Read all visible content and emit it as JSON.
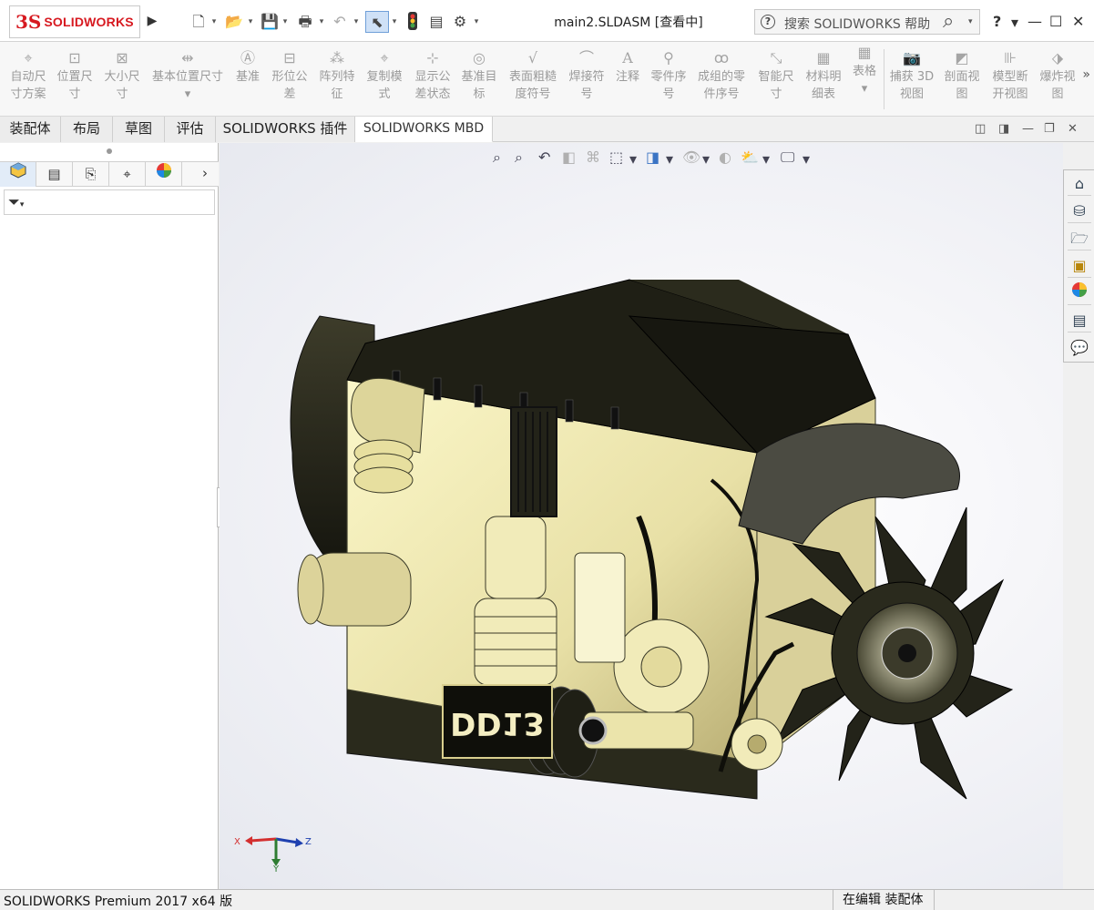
{
  "app": {
    "logo_ds": "3S",
    "logo_text": "SOLIDWORKS",
    "document_title": "main2.SLDASM [查看中]"
  },
  "search": {
    "help_icon": "?",
    "placeholder": "搜索 SOLIDWORKS 帮助"
  },
  "title_buttons": {
    "help": "?",
    "minimize": "—",
    "maximize": "☐",
    "close": "✕"
  },
  "command_manager": {
    "items": [
      {
        "l1": "自动尺",
        "l2": "寸方案"
      },
      {
        "l1": "位置尺",
        "l2": "寸"
      },
      {
        "l1": "大小尺",
        "l2": "寸"
      },
      {
        "l1": "基本位置尺寸",
        "l2": "▾"
      },
      {
        "l1": "基准",
        "l2": ""
      },
      {
        "l1": "形位公",
        "l2": "差"
      },
      {
        "l1": "阵列特",
        "l2": "征"
      },
      {
        "l1": "复制模",
        "l2": "式"
      },
      {
        "l1": "显示公",
        "l2": "差状态"
      },
      {
        "l1": "基准目",
        "l2": "标"
      },
      {
        "l1": "表面粗糙",
        "l2": "度符号"
      },
      {
        "l1": "焊接符",
        "l2": "号"
      },
      {
        "l1": "注释",
        "l2": ""
      },
      {
        "l1": "零件序",
        "l2": "号"
      },
      {
        "l1": "成组的零",
        "l2": "件序号"
      },
      {
        "l1": "智能尺",
        "l2": "寸"
      },
      {
        "l1": "材料明",
        "l2": "细表"
      },
      {
        "l1": "表格",
        "l2": "▾"
      },
      {
        "l1": "捕获 3D",
        "l2": "视图"
      },
      {
        "l1": "剖面视",
        "l2": "图"
      },
      {
        "l1": "模型断",
        "l2": "开视图"
      },
      {
        "l1": "爆炸视",
        "l2": "图"
      }
    ],
    "more": "»"
  },
  "tabs": [
    {
      "label": "装配体"
    },
    {
      "label": "布局"
    },
    {
      "label": "草图"
    },
    {
      "label": "评估"
    },
    {
      "label": "SOLIDWORKS 插件"
    },
    {
      "label": "SOLIDWORKS MBD"
    }
  ],
  "active_tab": "SOLIDWORKS MBD",
  "triad": {
    "x": "X",
    "y": "Y",
    "z": "Z"
  },
  "model_plate_text": "DD13",
  "status": {
    "left": "SOLIDWORKS Premium 2017 x64 版",
    "right": "在编辑 装配体"
  }
}
